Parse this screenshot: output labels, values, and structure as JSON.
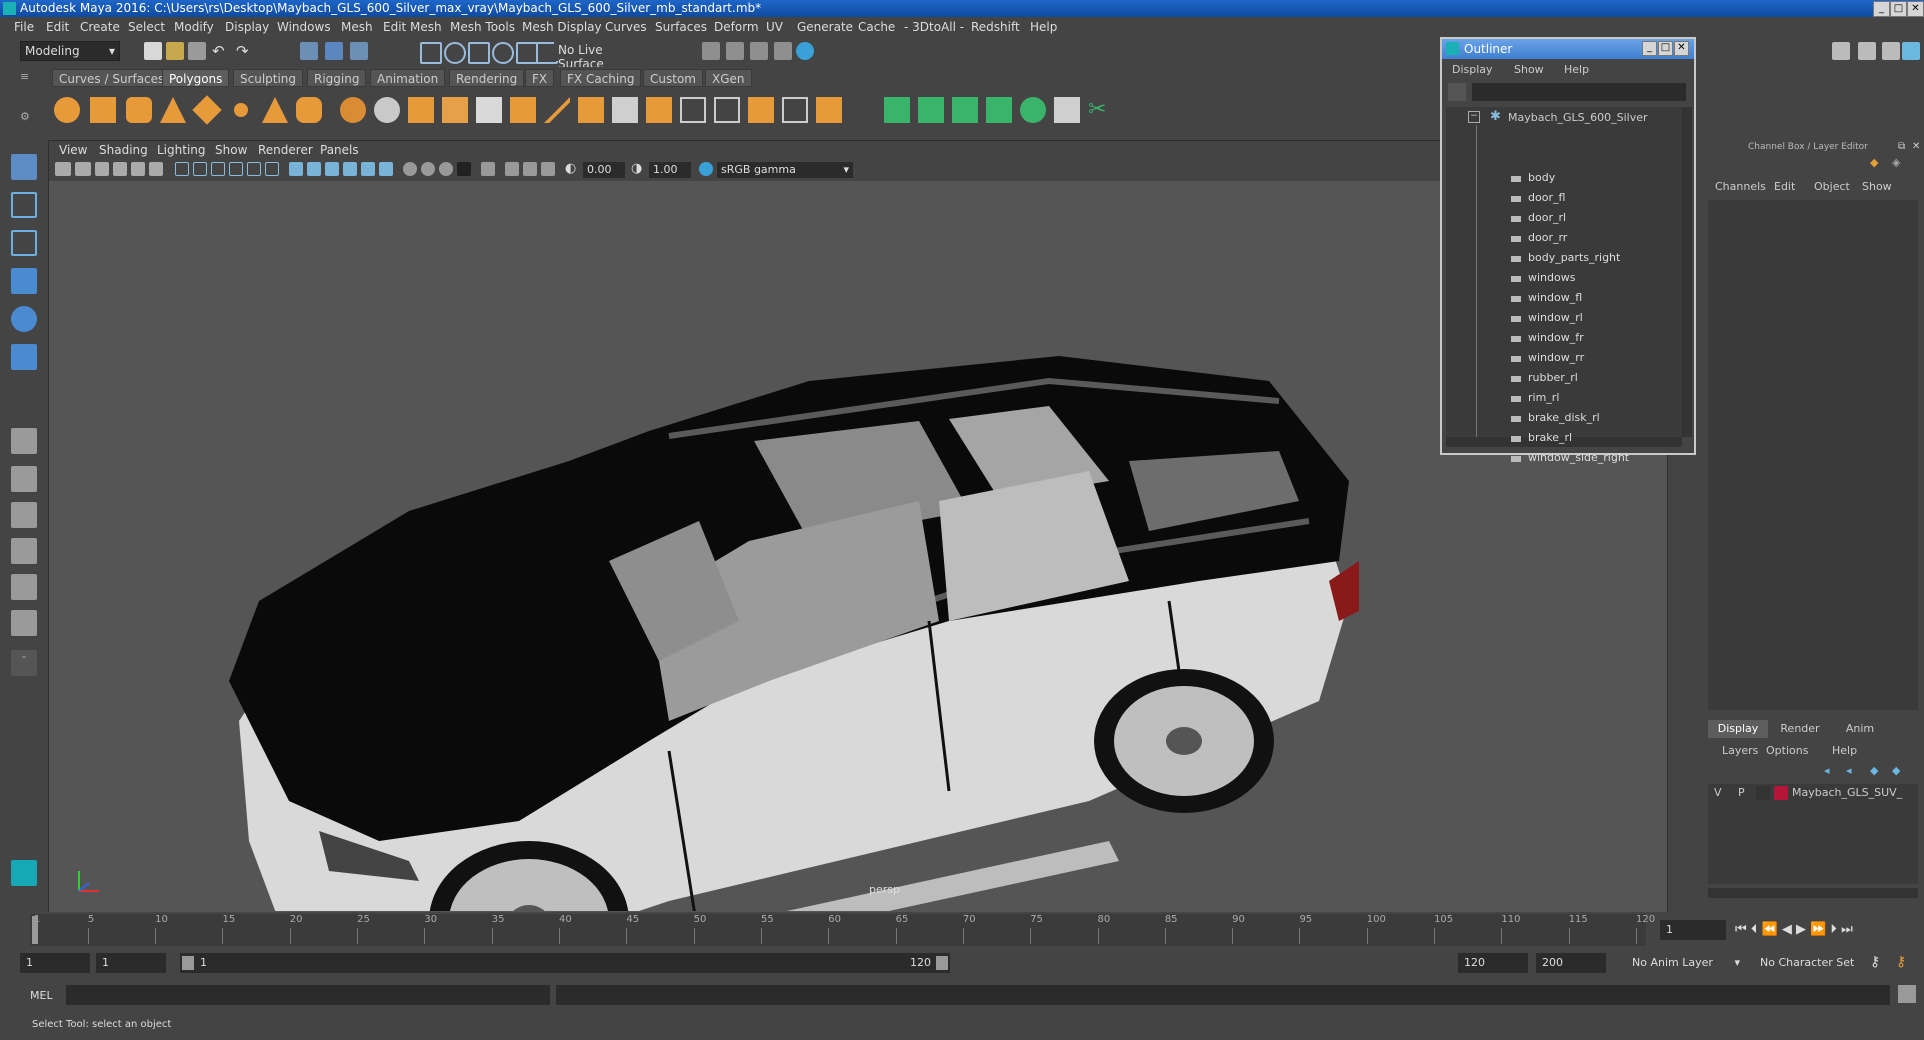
{
  "window": {
    "title": "Autodesk Maya 2016: C:\\Users\\rs\\Desktop\\Maybach_GLS_600_Silver_max_vray\\Maybach_GLS_600_Silver_mb_standart.mb*"
  },
  "menubar": [
    "File",
    "Edit",
    "Create",
    "Select",
    "Modify",
    "Display",
    "Windows",
    "Mesh",
    "Edit Mesh",
    "Mesh Tools",
    "Mesh Display",
    "Curves",
    "Surfaces",
    "Deform",
    "UV",
    "Generate",
    "Cache",
    "- 3DtoAll -",
    "Redshift",
    "Help"
  ],
  "statusline": {
    "mode": "Modeling",
    "live_surface": "No Live Surface"
  },
  "shelf_tabs": [
    "Curves / Surfaces",
    "Polygons",
    "Sculpting",
    "Rigging",
    "Animation",
    "Rendering",
    "FX",
    "FX Caching",
    "Custom",
    "XGen"
  ],
  "shelf_active": "Polygons",
  "viewport": {
    "menu": [
      "View",
      "Shading",
      "Lighting",
      "Show",
      "Renderer",
      "Panels"
    ],
    "exposure": "0.00",
    "gamma": "1.00",
    "color_space": "sRGB gamma",
    "camera_label": "persp"
  },
  "outliner": {
    "title": "Outliner",
    "menu": [
      "Display",
      "Show",
      "Help"
    ],
    "root": "Maybach_GLS_600_Silver",
    "items": [
      "body",
      "door_fl",
      "door_rl",
      "door_rr",
      "body_parts_right",
      "windows",
      "window_fl",
      "window_rl",
      "window_fr",
      "window_rr",
      "rubber_rl",
      "rim_rl",
      "brake_disk_rl",
      "brake_rl",
      "window_side_right"
    ]
  },
  "channelbox": {
    "title": "Channel Box / Layer Editor",
    "menu": [
      "Channels",
      "Edit",
      "Object",
      "Show"
    ],
    "layer_tabs": [
      "Display",
      "Render",
      "Anim"
    ],
    "layer_menu": [
      "Layers",
      "Options",
      "Help"
    ],
    "layer": {
      "v": "V",
      "p": "P",
      "name": "Maybach_GLS_SUV_",
      "color": "#b4163a"
    }
  },
  "timeline": {
    "ticks": [
      "1",
      "5",
      "10",
      "15",
      "20",
      "25",
      "30",
      "35",
      "40",
      "45",
      "50",
      "55",
      "60",
      "65",
      "70",
      "75",
      "80",
      "85",
      "90",
      "95",
      "100",
      "105",
      "110",
      "115",
      "120"
    ],
    "current_frame": "1"
  },
  "range": {
    "start": "1",
    "start_inner": "1",
    "slider_start": "1",
    "slider_end": "120",
    "end_inner": "120",
    "end": "200",
    "anim_layer": "No Anim Layer",
    "char_set": "No Character Set"
  },
  "cmdline": {
    "lang": "MEL"
  },
  "helpline": {
    "text": "Select Tool: select an object"
  },
  "colors": {
    "title_blue": "#1a5fc0",
    "maya_teal": "#1ab0b6",
    "shelf_orange": "#e69a3a",
    "shelf_green": "#39b46a"
  }
}
